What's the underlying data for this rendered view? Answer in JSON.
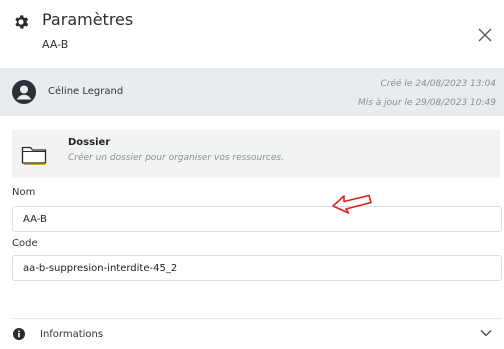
{
  "header": {
    "title": "Paramètres",
    "subtitle": "AA-B",
    "icon": "gear-icon",
    "close_icon": "close-icon"
  },
  "user": {
    "name": "Céline Legrand",
    "created": "Créé le 24/08/2023 13:04",
    "updated": "Mis à jour le 29/08/2023 10:49",
    "icon": "avatar-icon"
  },
  "card": {
    "icon": "folder-icon",
    "title": "Dossier",
    "description": "Créer un dossier pour organiser vos ressources."
  },
  "form": {
    "name_label": "Nom",
    "name_value": "AA-B",
    "code_label": "Code",
    "code_value": "aa-b-suppresion-interdite-45_2"
  },
  "annotation": {
    "icon": "red-arrow-icon",
    "color": "#e02020"
  },
  "informations": {
    "label": "Informations",
    "icon": "info-icon",
    "chevron": "chevron-down-icon"
  }
}
